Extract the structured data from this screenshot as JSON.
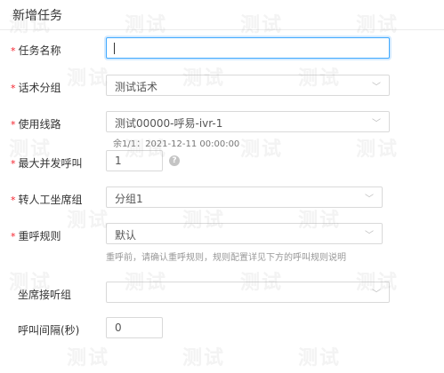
{
  "header": {
    "title": "新增任务"
  },
  "form": {
    "task_name": {
      "label": "任务名称",
      "value": ""
    },
    "script": {
      "label": "话术分组",
      "value": "测试话术"
    },
    "line": {
      "label": "使用线路",
      "value": "测试00000-呼易-ivr-1",
      "note": "余1/1：2021-12-11 00:00:00"
    },
    "max_concurrency": {
      "label": "最大并发呼叫",
      "value": "1"
    },
    "transfer_group": {
      "label": "转人工坐席组",
      "value": "分组1"
    },
    "retry_rule": {
      "label": "重呼规则",
      "value": "默认",
      "hint": "重呼前，请确认重呼规则，规则配置详见下方的呼叫规则说明"
    },
    "agent_group": {
      "label": "坐席接听组",
      "value": ""
    },
    "interval": {
      "label": "呼叫间隔(秒)",
      "value": "0"
    }
  },
  "watermark": {
    "text": "测试"
  }
}
